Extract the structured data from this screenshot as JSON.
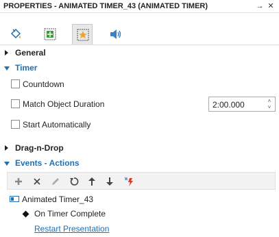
{
  "panel": {
    "title": "PROPERTIES - ANIMATED TIMER_43 (ANIMATED TIMER)",
    "pin_icon": "pin-icon",
    "close_icon": "close-icon"
  },
  "tabs": [
    {
      "icon": "paint-bucket-icon"
    },
    {
      "icon": "size-position-icon"
    },
    {
      "icon": "star-effects-icon",
      "active": true
    },
    {
      "icon": "sound-icon"
    }
  ],
  "sections": {
    "general": "General",
    "timer": "Timer",
    "drag_n_drop": "Drag-n-Drop",
    "events_actions": "Events - Actions"
  },
  "timer": {
    "countdown": "Countdown",
    "match_object_duration": "Match Object Duration",
    "duration_value": "2:00.000",
    "start_automatically": "Start Automatically"
  },
  "events_toolbar": [
    "add-icon",
    "delete-icon",
    "edit-icon",
    "undo-icon",
    "move-up-icon",
    "move-down-icon",
    "wand-icon"
  ],
  "events": {
    "object": "Animated Timer_43",
    "event": "On Timer Complete",
    "action": "Restart Presentation"
  },
  "colors": {
    "accent": "#1f6fb3",
    "icon_blue": "#3b82c4",
    "icon_orange": "#f0a22e",
    "icon_green": "#3d9a3d",
    "icon_red": "#d9392b"
  }
}
